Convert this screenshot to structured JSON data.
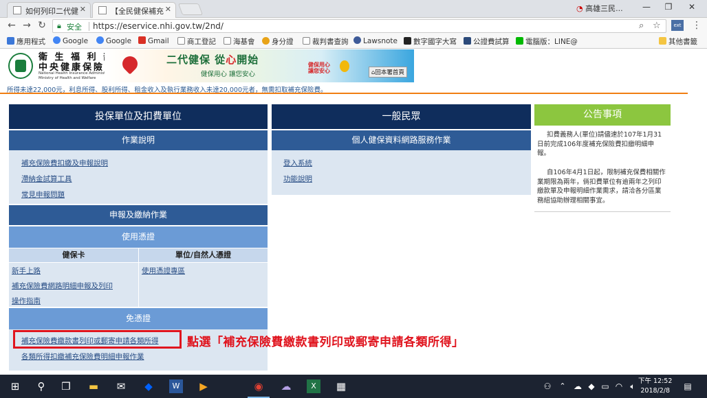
{
  "browser": {
    "tabs": [
      {
        "title": "如何列印二代健"
      },
      {
        "title": "【全民健保補充"
      }
    ],
    "profile_name": "高雄三民...",
    "url_secure_label": "安全",
    "url": "https://eservice.nhi.gov.tw/2nd/",
    "bookmarks": [
      "應用程式",
      "Google",
      "Google",
      "Gmail",
      "商工登記",
      "海基會",
      "身分證",
      "裁判書查詢",
      "Lawsnote",
      "數字國字大寫",
      "公證費試算",
      "電腦版：LINE@"
    ],
    "other_bookmarks": "其他書籤"
  },
  "site": {
    "org_name_line1": "衛 生 福 利 部",
    "org_name_line2": "中央健康保險署",
    "org_en_line1": "National Health Insurance Administration,",
    "org_en_line2": "Ministry of Health and Welfare",
    "banner_title_a": "二代健保 從",
    "banner_title_red": "心",
    "banner_title_b": "開始",
    "banner_sub": "健保用心 讓您安心",
    "banner_bubble_1": "健保用心",
    "banner_bubble_2": "讓您安心",
    "home_link": "回本署首頁",
    "marquee": "所得未達22,000元，利息所得、股利所得、租金收入及執行業務收入未達20,000元者，無需扣取補充保險費。"
  },
  "panel_employer": {
    "title": "投保單位及扣費單位",
    "section_ops": "作業說明",
    "ops_links": [
      "補充保險費扣繳及申報說明",
      "滯納金試算工具",
      "常見申報問題"
    ],
    "section_declare": "申報及繳納作業",
    "section_cert": "使用憑證",
    "col_card": "健保卡",
    "col_unit": "單位/自然人憑證",
    "card_links": [
      "新手上路",
      "補充保險費網路明細申報及列印",
      "操作指南"
    ],
    "unit_links": [
      "使用憑證專區"
    ],
    "section_nocert": "免憑證",
    "nocert_links": [
      "補充保險費繳款書列印或郵寄申請各類所得",
      "各類所得扣繳補充保險費明細申報作業"
    ]
  },
  "panel_public": {
    "title": "一般民眾",
    "section": "個人健保資料網路服務作業",
    "links": [
      "登入系統",
      "功能說明"
    ]
  },
  "panel_news": {
    "title": "公告事項",
    "items": [
      [
        "扣費義務人(單位)請儘速於107年1月31",
        "日前完成106年度補充保險費扣繳明細申",
        "報。"
      ],
      [
        "自106年4月1日起，限制補充保費相關作",
        "業期限為兩年，倘扣費單位有逾兩年之列印",
        "繳款單及申報明細作業需求，請洽各分區業",
        "務組協助辦理相關事宜。"
      ]
    ]
  },
  "annotation": {
    "callout": "點選「補充保險費繳款書列印或郵寄申請各類所得」"
  },
  "taskbar": {
    "time": "下午 12:52",
    "date": "2018/2/8"
  }
}
